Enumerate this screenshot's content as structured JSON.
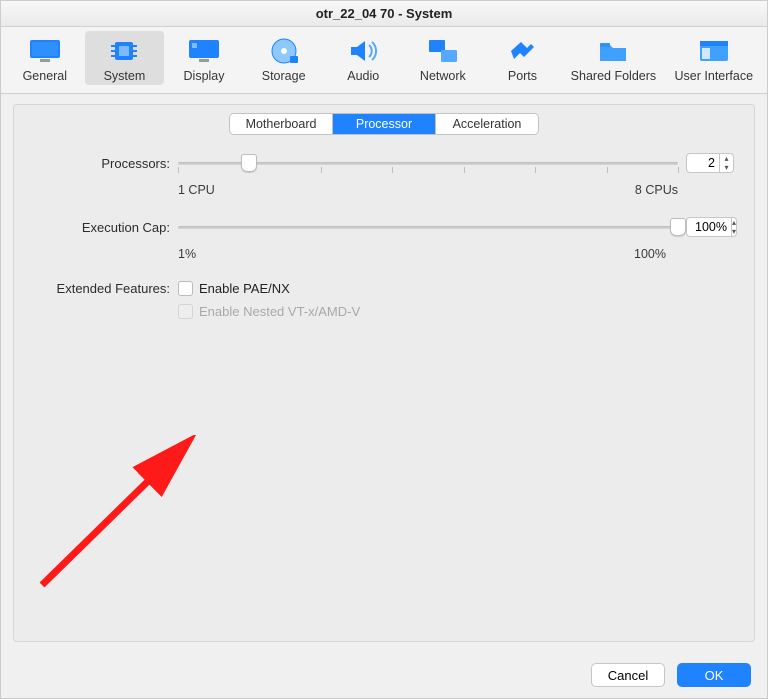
{
  "window": {
    "title": "otr_22_04 70 - System"
  },
  "toolbar": {
    "items": [
      {
        "label": "General"
      },
      {
        "label": "System"
      },
      {
        "label": "Display"
      },
      {
        "label": "Storage"
      },
      {
        "label": "Audio"
      },
      {
        "label": "Network"
      },
      {
        "label": "Ports"
      },
      {
        "label": "Shared Folders"
      },
      {
        "label": "User Interface"
      }
    ],
    "selected_index": 1
  },
  "tabs": {
    "items": [
      "Motherboard",
      "Processor",
      "Acceleration"
    ],
    "selected_index": 1
  },
  "processors": {
    "label": "Processors:",
    "min_label": "1 CPU",
    "max_label": "8 CPUs",
    "value": "2",
    "min": 1,
    "max": 8
  },
  "execution_cap": {
    "label": "Execution Cap:",
    "min_label": "1%",
    "max_label": "100%",
    "value": "100%",
    "percent": 100
  },
  "extended_features": {
    "label": "Extended Features:",
    "pae_label": "Enable PAE/NX",
    "nested_label": "Enable Nested VT-x/AMD-V"
  },
  "footer": {
    "cancel": "Cancel",
    "ok": "OK"
  }
}
